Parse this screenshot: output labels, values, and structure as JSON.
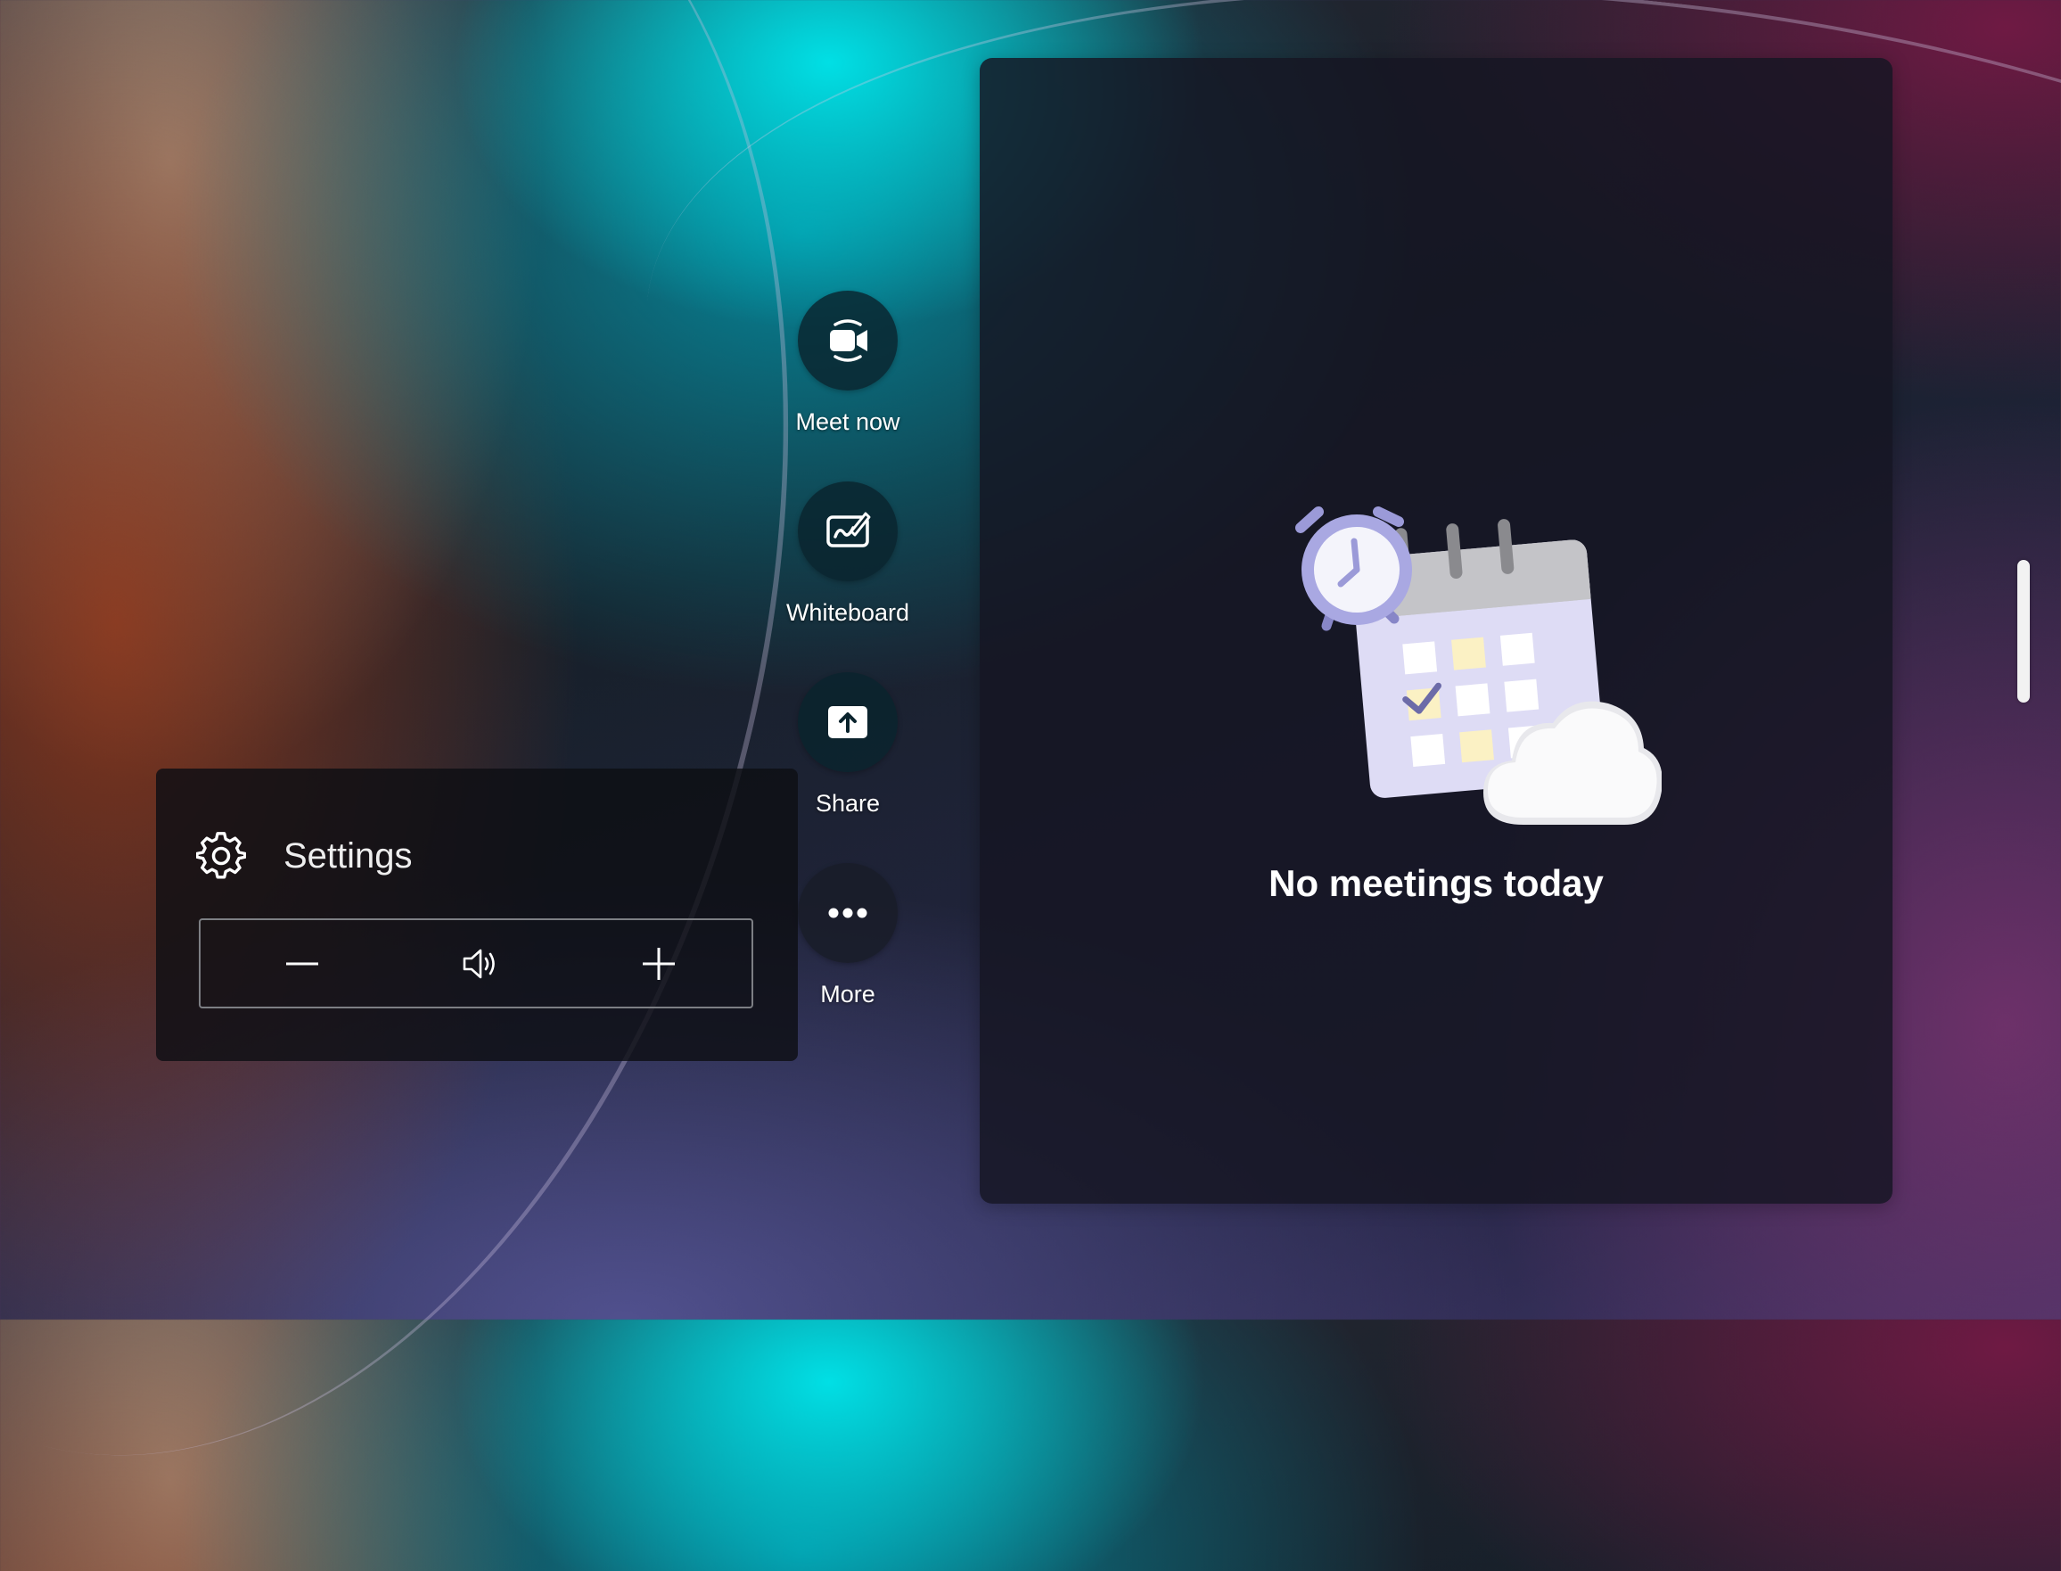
{
  "actions": [
    {
      "label": "Meet now",
      "icon": "video-camera-icon"
    },
    {
      "label": "Whiteboard",
      "icon": "whiteboard-pen-icon"
    },
    {
      "label": "Share",
      "icon": "share-upload-icon"
    },
    {
      "label": "More",
      "icon": "ellipsis-icon"
    }
  ],
  "settings": {
    "label": "Settings",
    "icon": "gear-icon",
    "volume": {
      "decrease_icon": "minus-icon",
      "speaker_icon": "speaker-icon",
      "increase_icon": "plus-icon"
    }
  },
  "meetings": {
    "empty_message": "No meetings today",
    "illustration": "calendar-clock-cloud-illustration"
  },
  "colors": {
    "action_circle": "#0a232d",
    "panel_bg": "#0e0f14",
    "card_bg": "#161622",
    "illustration_accent": "#9b9ad8"
  }
}
